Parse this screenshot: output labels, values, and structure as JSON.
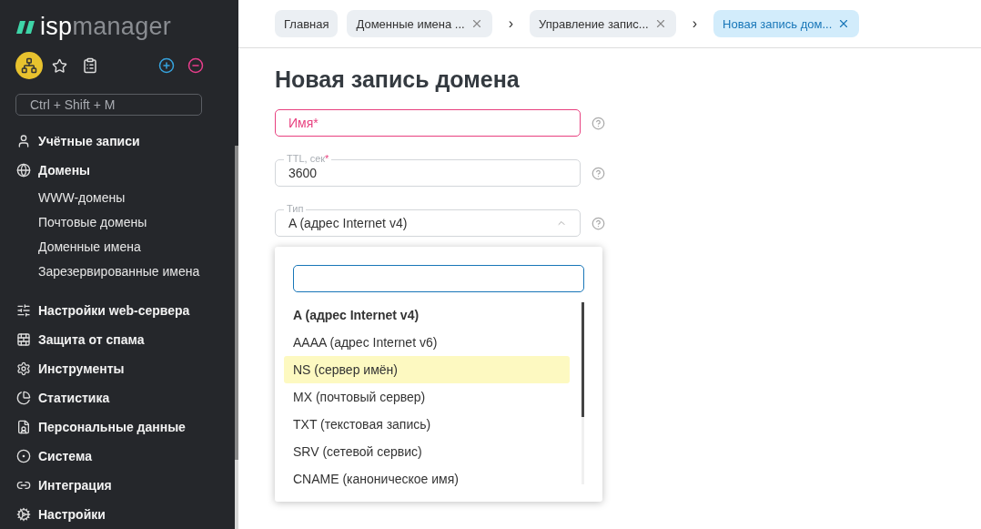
{
  "logo": {
    "part_1": "isp",
    "part_2": "manager"
  },
  "quick_search": {
    "placeholder": "Ctrl + Shift + M"
  },
  "sidebar": {
    "items": [
      {
        "label": "Учётные записи"
      },
      {
        "label": "Домены",
        "children": [
          {
            "label": "WWW-домены"
          },
          {
            "label": "Почтовые домены"
          },
          {
            "label": "Доменные имена"
          },
          {
            "label": "Зарезервированные имена"
          }
        ]
      },
      {
        "label": "Настройки web-сервера"
      },
      {
        "label": "Защита от спама"
      },
      {
        "label": "Инструменты"
      },
      {
        "label": "Статистика"
      },
      {
        "label": "Персональные данные"
      },
      {
        "label": "Система"
      },
      {
        "label": "Интеграция"
      },
      {
        "label": "Настройки"
      }
    ]
  },
  "breadcrumbs": [
    {
      "label": "Главная",
      "closable": false,
      "selected": false
    },
    {
      "label": "Доменные имена ...",
      "closable": true,
      "selected": false
    },
    {
      "separator": "›",
      "label": "Управление запис...",
      "closable": true,
      "selected": false
    },
    {
      "separator": "›",
      "label": "Новая запись дом...",
      "closable": true,
      "selected": true
    }
  ],
  "form": {
    "title": "Новая запись домена",
    "fields": [
      {
        "kind": "text",
        "label": "Имя",
        "required_mark": "*",
        "invalid": true
      },
      {
        "kind": "text",
        "label": "TTL, сек",
        "required_mark": "*",
        "value": "3600",
        "invalid": false
      },
      {
        "kind": "select",
        "label": "Тип",
        "value": "A (адрес Internet v4)",
        "expanded": true,
        "invalid": false
      }
    ]
  },
  "dropdown": {
    "options": [
      {
        "label": "A (адрес Internet v4)",
        "selected": true,
        "highlighted": false
      },
      {
        "label": "AAAA (адрес Internet v6)",
        "selected": false,
        "highlighted": false
      },
      {
        "label": "NS (сервер имён)",
        "selected": false,
        "highlighted": true
      },
      {
        "label": "MX (почтовый сервер)",
        "selected": false,
        "highlighted": false
      },
      {
        "label": "TXT (текстовая запись)",
        "selected": false,
        "highlighted": false
      },
      {
        "label": "SRV (сетевой сервис)",
        "selected": false,
        "highlighted": false
      },
      {
        "label": "CNAME (каноническое имя)",
        "selected": false,
        "highlighted": false
      }
    ]
  }
}
